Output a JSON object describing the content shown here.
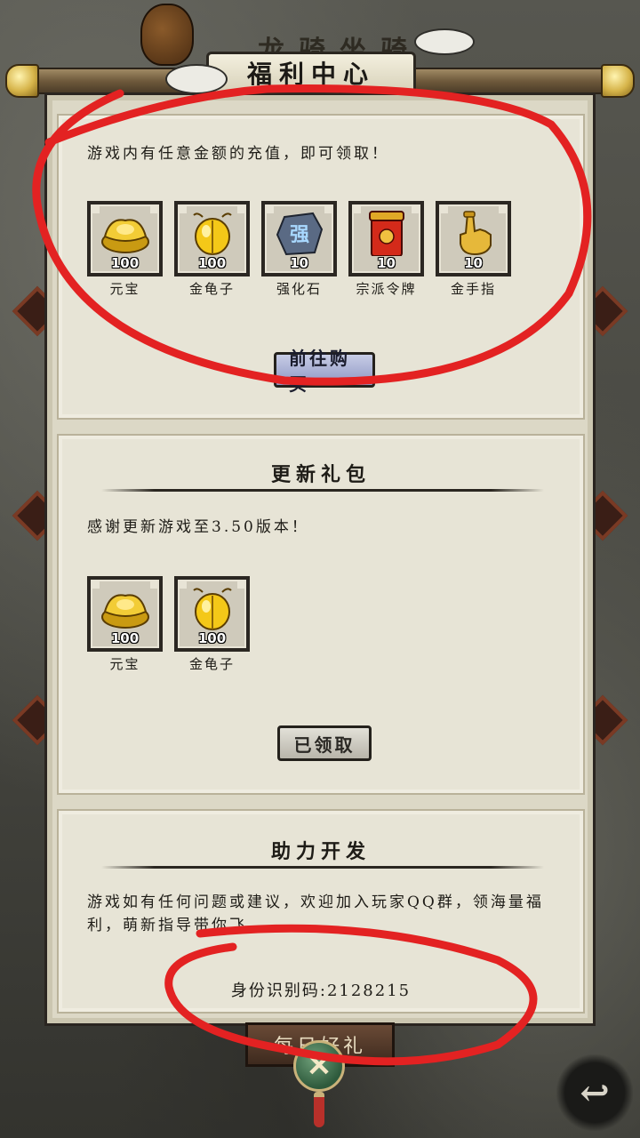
{
  "window": {
    "title": "福利中心",
    "bg_title": "龙骑坐骑"
  },
  "panel_recharge": {
    "description": "游戏内有任意金额的充值，即可领取！",
    "items": [
      {
        "name": "元宝",
        "count": "100",
        "icon": "gold-ingot-icon"
      },
      {
        "name": "金龟子",
        "count": "100",
        "icon": "golden-beetle-icon"
      },
      {
        "name": "强化石",
        "count": "10",
        "icon": "strengthen-stone-icon"
      },
      {
        "name": "宗派令牌",
        "count": "10",
        "icon": "sect-token-icon"
      },
      {
        "name": "金手指",
        "count": "10",
        "icon": "golden-finger-icon"
      }
    ],
    "button_label": "前往购买"
  },
  "panel_update": {
    "title": "更新礼包",
    "description": "感谢更新游戏至3.50版本！",
    "items": [
      {
        "name": "元宝",
        "count": "100",
        "icon": "gold-ingot-icon"
      },
      {
        "name": "金龟子",
        "count": "100",
        "icon": "golden-beetle-icon"
      }
    ],
    "button_label": "已领取"
  },
  "panel_support": {
    "title": "助力开发",
    "description": "游戏如有任何问题或建议，欢迎加入玩家QQ群，领海量福利，萌新指导带你飞",
    "id_label": "身份识别码:2128215"
  },
  "bottom": {
    "plaque_label": "每日好礼",
    "close_icon": "close-icon",
    "back_icon": "back-icon"
  },
  "colors": {
    "annotation": "#e32222",
    "parchment": "#dcd8c6",
    "buy_button": "#a9b0d6"
  }
}
